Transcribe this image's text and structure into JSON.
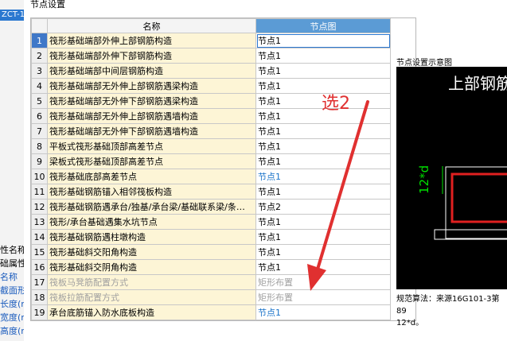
{
  "background": {
    "tab_label": "ZCT-1",
    "props": [
      {
        "text": "性名称",
        "highlight": false
      },
      {
        "text": "础属性",
        "highlight": false
      },
      {
        "text": "名称",
        "highlight": true
      },
      {
        "text": "截面形",
        "highlight": true
      },
      {
        "text": "长度(n",
        "highlight": true
      },
      {
        "text": "宽度(n",
        "highlight": true
      },
      {
        "text": "高度(n",
        "highlight": true
      }
    ]
  },
  "dialog": {
    "title": "节点设置",
    "columns": {
      "name": "名称",
      "node": "节点图"
    },
    "rows": [
      {
        "index": "1",
        "name": "筏形基础端部外伸上部钢筋构造",
        "node": "节点1",
        "style": "normal",
        "selected": true
      },
      {
        "index": "2",
        "name": "筏形基础端部外伸下部钢筋构造",
        "node": "节点1",
        "style": "normal",
        "selected": false
      },
      {
        "index": "3",
        "name": "筏形基础端部中间层钢筋构造",
        "node": "节点1",
        "style": "normal",
        "selected": false
      },
      {
        "index": "4",
        "name": "筏形基础端部无外伸上部钢筋遇梁构造",
        "node": "节点1",
        "style": "normal",
        "selected": false
      },
      {
        "index": "5",
        "name": "筏形基础端部无外伸下部钢筋遇梁构造",
        "node": "节点1",
        "style": "normal",
        "selected": false
      },
      {
        "index": "6",
        "name": "筏形基础端部无外伸上部钢筋遇墙构造",
        "node": "节点1",
        "style": "normal",
        "selected": false
      },
      {
        "index": "7",
        "name": "筏形基础端部无外伸下部钢筋遇墙构造",
        "node": "节点1",
        "style": "normal",
        "selected": false
      },
      {
        "index": "8",
        "name": "平板式筏形基础顶部高差节点",
        "node": "节点1",
        "style": "normal",
        "selected": false
      },
      {
        "index": "9",
        "name": "梁板式筏形基础顶部高差节点",
        "node": "节点1",
        "style": "normal",
        "selected": false
      },
      {
        "index": "10",
        "name": "筏形基础底部高差节点",
        "node": "节点1",
        "style": "blue",
        "selected": false
      },
      {
        "index": "11",
        "name": "筏形基础钢筋锚入相邻筏板构造",
        "node": "节点1",
        "style": "normal",
        "selected": false
      },
      {
        "index": "12",
        "name": "筏形基础钢筋遇承台/独基/承台梁/基础联系梁/条…",
        "node": "节点2",
        "style": "normal",
        "selected": false
      },
      {
        "index": "13",
        "name": "筏形/承台基础遇集水坑节点",
        "node": "节点1",
        "style": "normal",
        "selected": false
      },
      {
        "index": "14",
        "name": "筏形基础钢筋遇柱墩构造",
        "node": "节点1",
        "style": "normal",
        "selected": false
      },
      {
        "index": "15",
        "name": "筏形基础斜交阳角构造",
        "node": "节点1",
        "style": "normal",
        "selected": false
      },
      {
        "index": "16",
        "name": "筏形基础斜交阴角构造",
        "node": "节点1",
        "style": "normal",
        "selected": false
      },
      {
        "index": "17",
        "name": "筏板马凳筋配置方式",
        "node": "矩形布置",
        "style": "disabled",
        "selected": false
      },
      {
        "index": "18",
        "name": "筏板拉筋配置方式",
        "node": "矩形布置",
        "style": "disabled",
        "selected": false
      },
      {
        "index": "19",
        "name": "承台底筋锚入防水底板构造",
        "node": "节点1",
        "style": "blue",
        "selected": false
      }
    ],
    "preview": {
      "label": "节点设置示意图",
      "heading": "上部钢筋",
      "dimension": "12*d"
    },
    "formula": {
      "line1": "规范算法：来源16G101-3第89",
      "line2": "12*d。"
    }
  },
  "annotation": {
    "text": "选2",
    "color": "#e03030"
  }
}
